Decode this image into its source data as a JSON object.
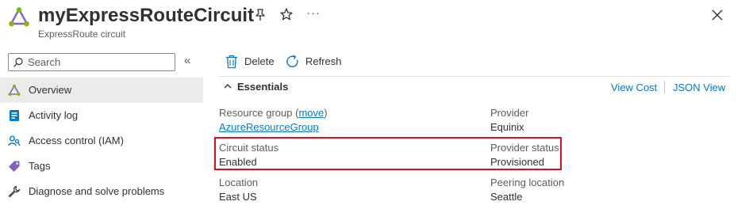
{
  "header": {
    "title": "myExpressRouteCircuit",
    "subtitle": "ExpressRoute circuit",
    "more_label": "···"
  },
  "sidebar": {
    "search_placeholder": "Search",
    "collapse_label": "«",
    "items": [
      {
        "label": "Overview",
        "icon": "expressroute-icon",
        "active": true
      },
      {
        "label": "Activity log",
        "icon": "activity-log-icon"
      },
      {
        "label": "Access control (IAM)",
        "icon": "iam-icon"
      },
      {
        "label": "Tags",
        "icon": "tag-icon"
      },
      {
        "label": "Diagnose and solve problems",
        "icon": "wrench-icon"
      }
    ]
  },
  "toolbar": {
    "delete_label": "Delete",
    "refresh_label": "Refresh"
  },
  "essentials": {
    "title": "Essentials",
    "view_cost_label": "View Cost",
    "json_view_label": "JSON View",
    "resource_group_label": "Resource group (",
    "resource_group_move": "move",
    "resource_group_close": ")",
    "resource_group_value": "AzureResourceGroup",
    "provider_label": "Provider",
    "provider_value": "Equinix",
    "circuit_status_label": "Circuit status",
    "circuit_status_value": "Enabled",
    "provider_status_label": "Provider status",
    "provider_status_value": "Provisioned",
    "location_label": "Location",
    "location_value": "East US",
    "peering_location_label": "Peering location",
    "peering_location_value": "Seattle"
  },
  "colors": {
    "accent": "#0078d4",
    "highlight": "#e00b1c",
    "active_bg": "#edebe9",
    "icon_purple": "#8661c5",
    "icon_green": "#5ea0ef"
  }
}
